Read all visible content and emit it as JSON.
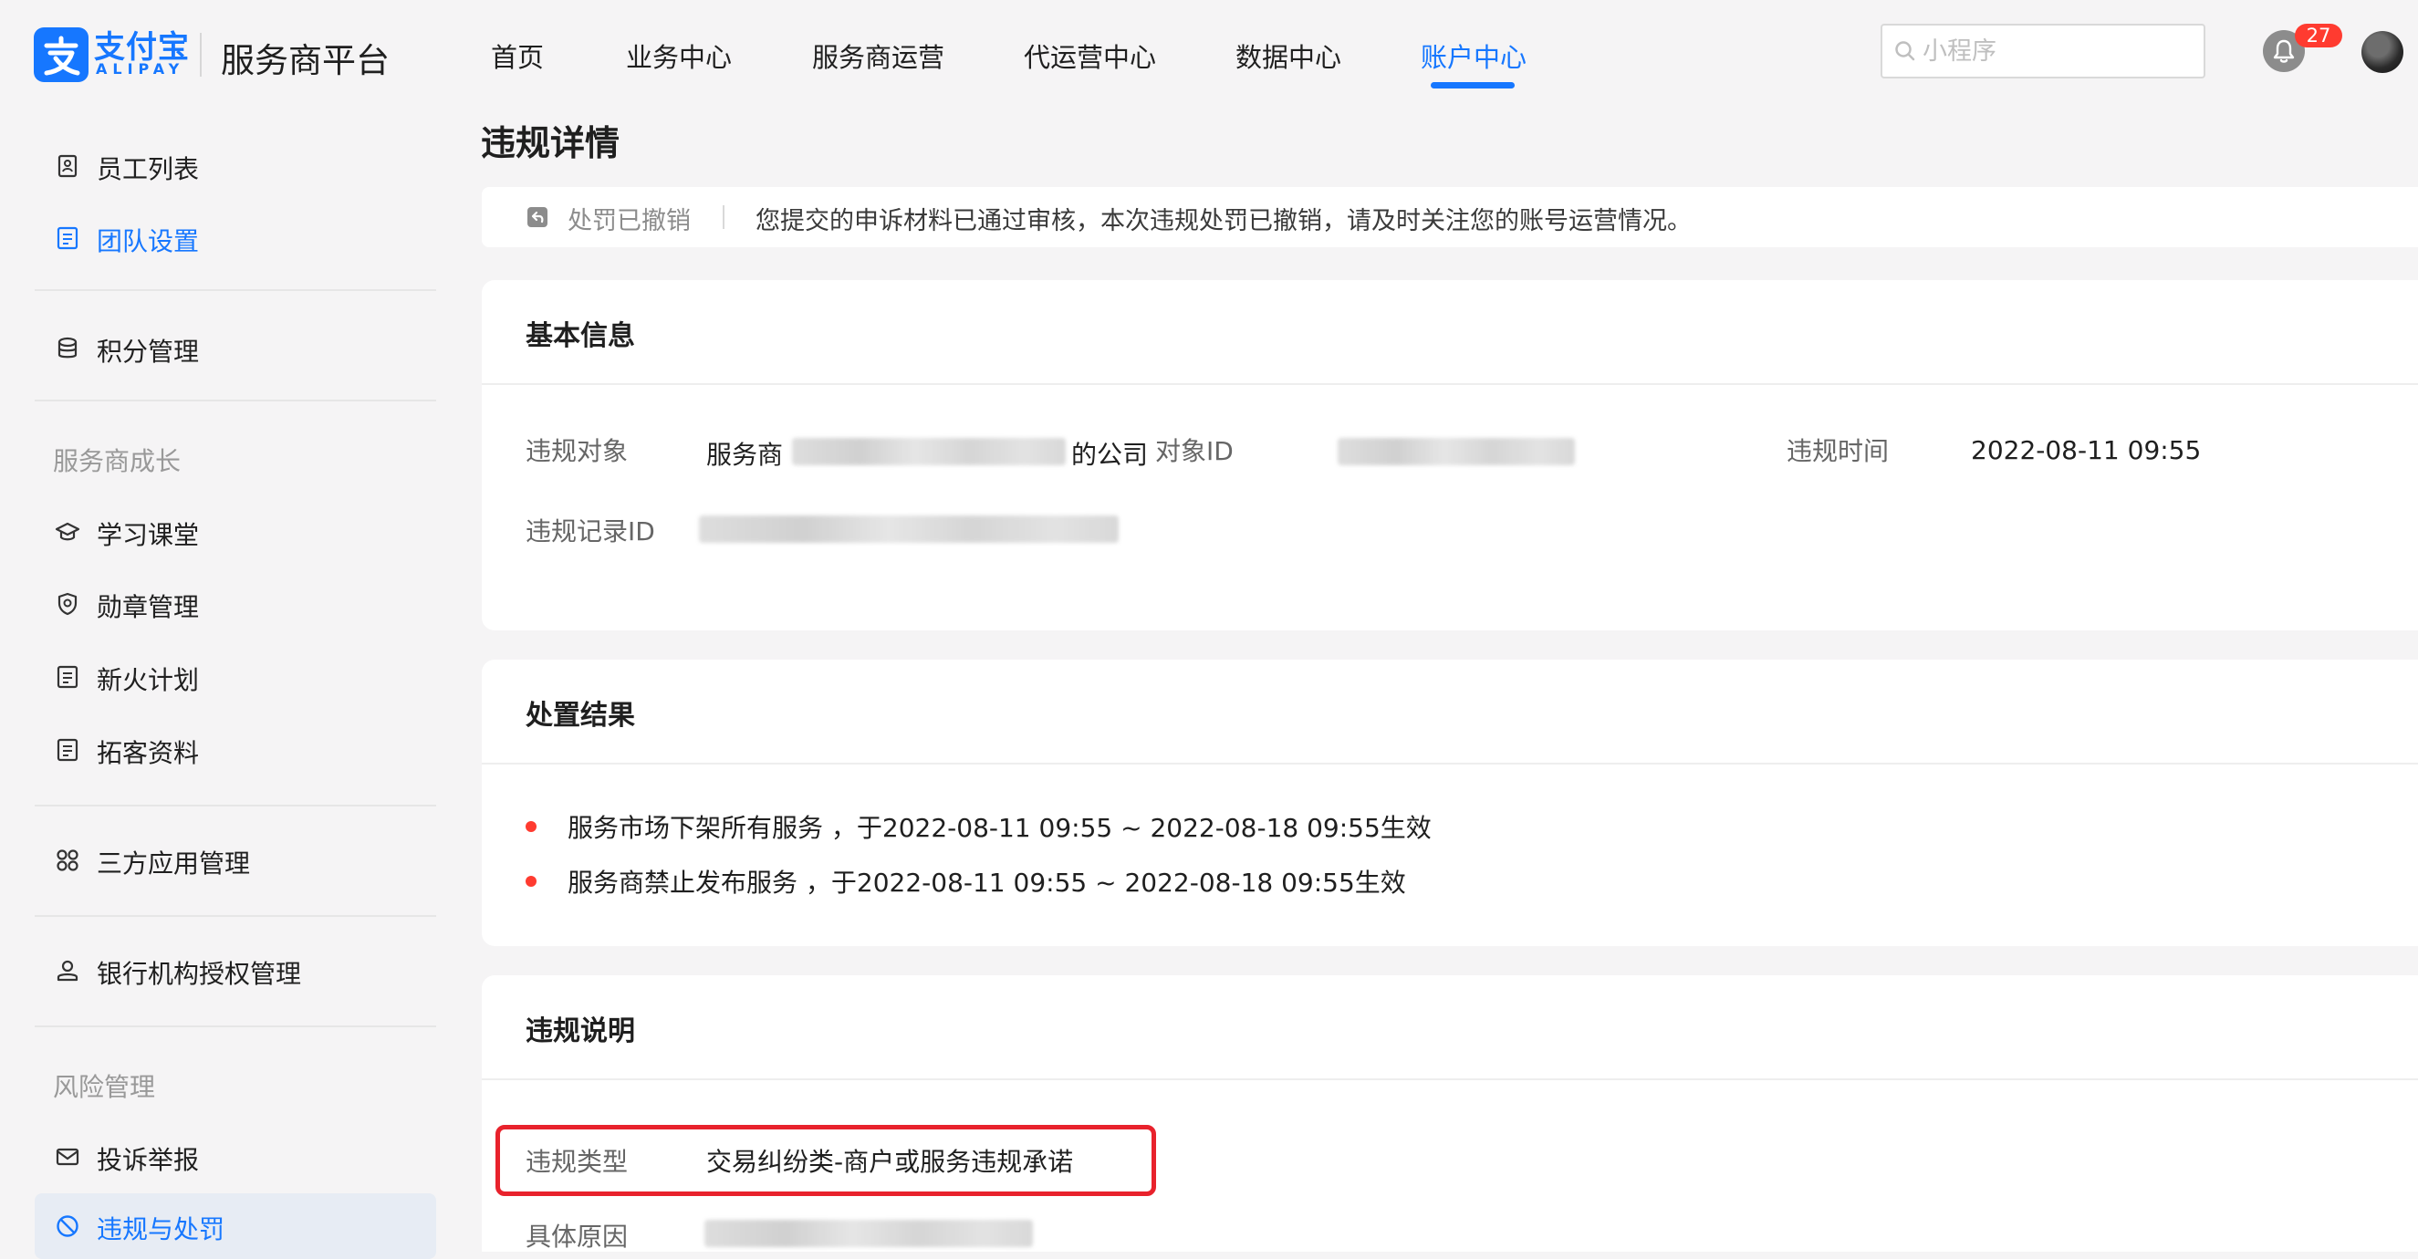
{
  "header": {
    "logo_cn": "支付宝",
    "logo_en": "ALIPAY",
    "platform_name": "服务商平台",
    "nav": [
      {
        "label": "首页"
      },
      {
        "label": "业务中心"
      },
      {
        "label": "服务商运营"
      },
      {
        "label": "代运营中心"
      },
      {
        "label": "数据中心"
      },
      {
        "label": "账户中心",
        "active": true
      }
    ],
    "search_placeholder": "小程序",
    "notification_count": "27",
    "icons": {
      "search": "search-icon",
      "bell": "bell-icon",
      "avatar": "user-avatar"
    }
  },
  "sidebar": {
    "items": [
      {
        "label": "员工列表",
        "icon": "staff-icon"
      },
      {
        "label": "团队设置",
        "icon": "document-icon",
        "active": true
      },
      {
        "label": "积分管理",
        "icon": "database-icon"
      },
      {
        "label": "学习课堂",
        "icon": "graduation-cap-icon"
      },
      {
        "label": "勋章管理",
        "icon": "shield-badge-icon"
      },
      {
        "label": "新火计划",
        "icon": "document-icon"
      },
      {
        "label": "拓客资料",
        "icon": "document-icon"
      },
      {
        "label": "三方应用管理",
        "icon": "apps-icon"
      },
      {
        "label": "银行机构授权管理",
        "icon": "user-icon"
      },
      {
        "label": "投诉举报",
        "icon": "mail-icon"
      },
      {
        "label": "违规与处罚",
        "icon": "forbidden-icon",
        "selected": true
      }
    ],
    "groups": {
      "growth": "服务商成长",
      "risk": "风险管理"
    }
  },
  "main": {
    "title": "违规详情",
    "notice": {
      "status": "处罚已撤销",
      "text": "您提交的申诉材料已通过审核，本次违规处罚已撤销，请及时关注您的账号运营情况。"
    },
    "basic": {
      "title": "基本信息",
      "target_label": "违规对象",
      "target_prefix": "服务商",
      "target_suffix": "的公司",
      "object_id_label": "对象ID",
      "time_label": "违规时间",
      "time_value": "2022-08-11 09:55",
      "record_id_label": "违规记录ID"
    },
    "result": {
      "title": "处置结果",
      "items": [
        {
          "text": "服务市场下架所有服务 ，于2022-08-11 09:55 ~ 2022-08-18 09:55生效"
        },
        {
          "text": "服务商禁止发布服务 ，于2022-08-11 09:55 ~ 2022-08-18 09:55生效"
        }
      ]
    },
    "explain": {
      "title": "违规说明",
      "type_label": "违规类型",
      "type_value": "交易纠纷类-商户或服务违规承诺",
      "reason_label": "具体原因"
    }
  },
  "colors": {
    "accent": "#1677ff",
    "badge": "#ff3b30",
    "highlight_border": "#e8222c",
    "page_bg": "#f5f4f5"
  }
}
